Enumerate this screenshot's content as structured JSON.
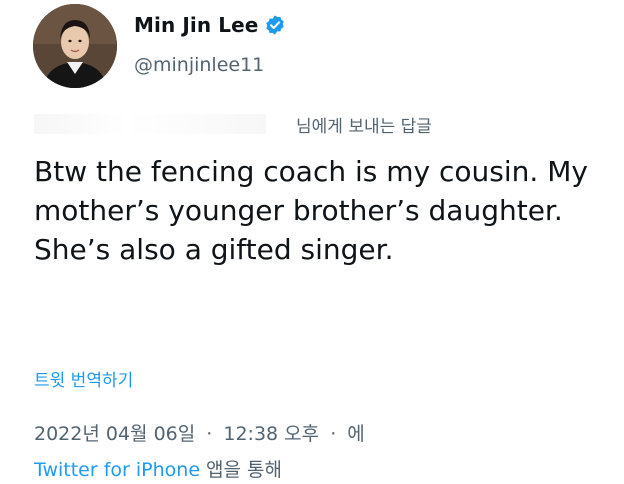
{
  "user": {
    "display_name": "Min Jin Lee",
    "handle": "@minjinlee11",
    "verified": true
  },
  "reply": {
    "suffix": "님에게 보내는 답글"
  },
  "tweet": {
    "text": "Btw the fencing coach is my cousin. My mother’s younger brother’s daughter. She’s also a gifted singer."
  },
  "actions": {
    "translate_label": "트윗 번역하기"
  },
  "meta": {
    "date": "2022년 04월 06일",
    "time": "12:38 오후",
    "trailing": "에",
    "separator": "·",
    "source": "Twitter for iPhone",
    "source_suffix": "앱을 통해"
  },
  "colors": {
    "text": "#0f1419",
    "secondary": "#536471",
    "accent": "#1d9bf0"
  },
  "icons": {
    "verified": "verified-badge-icon"
  }
}
